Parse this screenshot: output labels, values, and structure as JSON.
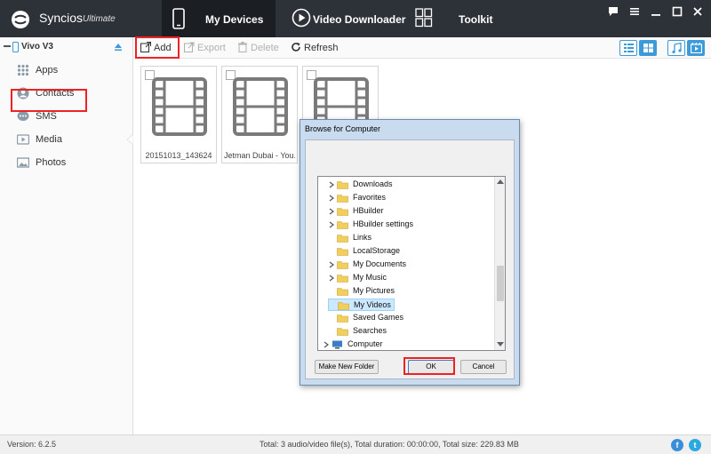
{
  "app": {
    "name": "Syncios",
    "edition": "Ultimate"
  },
  "nav": {
    "devices": "My Devices",
    "video": "Video Downloader",
    "toolkit": "Toolkit"
  },
  "device": {
    "name": "Vivo V3"
  },
  "sidebar": {
    "items": [
      {
        "label": "Apps",
        "icon": "apps-grid-icon"
      },
      {
        "label": "Contacts",
        "icon": "contacts-icon"
      },
      {
        "label": "SMS",
        "icon": "sms-icon"
      },
      {
        "label": "Media",
        "icon": "media-icon"
      },
      {
        "label": "Photos",
        "icon": "photos-icon"
      }
    ]
  },
  "toolbar": {
    "add": "Add",
    "export": "Export",
    "delete": "Delete",
    "refresh": "Refresh"
  },
  "tiles": [
    {
      "caption": "20151013_143624"
    },
    {
      "caption": "Jetman Dubai  - You..."
    },
    {
      "caption": ""
    }
  ],
  "dialog": {
    "title": "Browse for Computer",
    "tree": [
      "Downloads",
      "Favorites",
      "HBuilder",
      "HBuilder settings",
      "Links",
      "LocalStorage",
      "My Documents",
      "My Music",
      "My Pictures",
      "My Videos",
      "Saved Games",
      "Searches",
      "Computer"
    ],
    "selected": "My Videos",
    "new_folder": "Make New Folder",
    "ok": "OK",
    "cancel": "Cancel"
  },
  "status": {
    "version": "Version: 6.2.5",
    "summary": "Total: 3 audio/video file(s), Total duration: 00:00:00, Total size: 229.83 MB"
  },
  "colors": {
    "titlebar": "#2d3238",
    "active_tab": "#1b1e22",
    "accent": "#3d9ad8",
    "highlight": "#e22222",
    "facebook": "#3b8fd8",
    "twitter": "#2aa9e0"
  }
}
